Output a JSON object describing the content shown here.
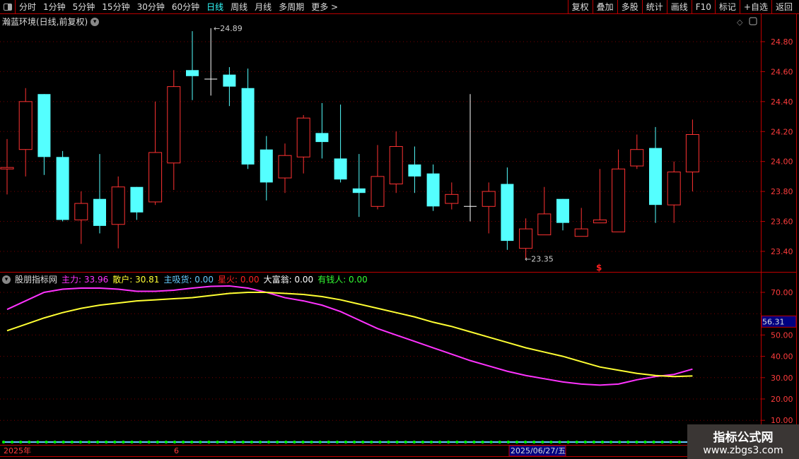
{
  "toolbar": {
    "periods": [
      "分时",
      "1分钟",
      "5分钟",
      "15分钟",
      "30分钟",
      "60分钟",
      "日线",
      "周线",
      "月线",
      "多周期",
      "更多 >"
    ],
    "active": "日线",
    "buttons": [
      "复权",
      "叠加",
      "多股",
      "统计",
      "画线",
      "F10",
      "标记",
      "+自选",
      "返回"
    ]
  },
  "main": {
    "title": "瀚蓝环境(日线,前复权)",
    "price_labels": [
      "24.80",
      "24.60",
      "24.40",
      "24.20",
      "24.00",
      "23.80",
      "23.60",
      "23.40"
    ],
    "high_label": "24.89",
    "low_label": "23.35",
    "marker": "$",
    "colors": {
      "up": "#ff3232",
      "down": "#54ffff",
      "doji": "#ffffff"
    },
    "candles": [
      [
        23.95,
        24.15,
        23.78,
        23.96
      ],
      [
        24.08,
        24.49,
        23.9,
        24.4
      ],
      [
        24.45,
        24.45,
        23.91,
        24.03
      ],
      [
        24.03,
        24.07,
        23.6,
        23.61
      ],
      [
        23.61,
        23.8,
        23.45,
        23.72
      ],
      [
        23.75,
        24.05,
        23.52,
        23.57
      ],
      [
        23.58,
        23.9,
        23.42,
        23.83
      ],
      [
        23.83,
        23.83,
        23.61,
        23.66
      ],
      [
        23.73,
        24.4,
        23.71,
        24.06
      ],
      [
        23.99,
        24.61,
        23.81,
        24.5
      ],
      [
        24.61,
        24.87,
        24.41,
        24.57
      ],
      [
        24.55,
        24.89,
        24.44,
        24.55
      ],
      [
        24.58,
        24.63,
        24.37,
        24.5
      ],
      [
        24.49,
        24.62,
        23.95,
        23.98
      ],
      [
        24.08,
        24.17,
        23.74,
        23.86
      ],
      [
        23.89,
        24.12,
        23.79,
        24.04
      ],
      [
        24.03,
        24.31,
        23.92,
        24.29
      ],
      [
        24.19,
        24.39,
        24.02,
        24.13
      ],
      [
        24.02,
        24.38,
        23.86,
        23.88
      ],
      [
        23.82,
        24.05,
        23.63,
        23.79
      ],
      [
        23.7,
        24.11,
        23.68,
        23.9
      ],
      [
        23.85,
        24.2,
        23.79,
        24.1
      ],
      [
        23.98,
        24.1,
        23.79,
        23.9
      ],
      [
        23.92,
        23.98,
        23.67,
        23.7
      ],
      [
        23.72,
        23.86,
        23.68,
        23.78
      ],
      [
        23.7,
        24.45,
        23.6,
        23.7
      ],
      [
        23.7,
        23.86,
        23.52,
        23.8
      ],
      [
        23.85,
        23.96,
        23.41,
        23.47
      ],
      [
        23.42,
        23.62,
        23.35,
        23.55
      ],
      [
        23.51,
        23.83,
        23.51,
        23.65
      ],
      [
        23.75,
        23.75,
        23.54,
        23.59
      ],
      [
        23.5,
        23.69,
        23.5,
        23.55
      ],
      [
        23.59,
        23.95,
        23.59,
        23.61
      ],
      [
        23.53,
        24.08,
        23.53,
        23.95
      ],
      [
        23.97,
        24.18,
        23.95,
        24.08
      ],
      [
        24.09,
        24.23,
        23.59,
        23.71
      ],
      [
        23.71,
        24.0,
        23.59,
        23.93
      ],
      [
        23.93,
        24.28,
        23.8,
        24.18
      ]
    ]
  },
  "indicator": {
    "name": "股朋指标网",
    "items": [
      {
        "label": "主力:",
        "value": "33.96",
        "color": "#ff33ff"
      },
      {
        "label": "散户:",
        "value": "30.81",
        "color": "#ffff33"
      },
      {
        "label": "主吸货:",
        "value": "0.00",
        "color": "#66ccff"
      },
      {
        "label": "星火:",
        "value": "0.00",
        "color": "#ff2020"
      },
      {
        "label": "大富翁:",
        "value": "0.00",
        "color": "#ffffff"
      },
      {
        "label": "有钱人:",
        "value": "0.00",
        "color": "#33ff33"
      }
    ],
    "axis_labels": [
      "70.00",
      "50.00",
      "40.00",
      "30.00",
      "20.00",
      "10.00"
    ],
    "cursor_value": "56.31",
    "zhuli": [
      62,
      66,
      70,
      71.5,
      72,
      72,
      71.5,
      70.5,
      70.5,
      71,
      72,
      72.8,
      73,
      72,
      70,
      67.5,
      66,
      64,
      61,
      57,
      53,
      50,
      47,
      44,
      41,
      38,
      35.5,
      33,
      31,
      29.5,
      28,
      27,
      26.5,
      27,
      29,
      30.5,
      31.5,
      34
    ],
    "sanhu": [
      52,
      55,
      58,
      60.5,
      62.5,
      64,
      65,
      66,
      66.5,
      67,
      67.5,
      68.5,
      69.5,
      70,
      70,
      69.5,
      69,
      68,
      66.5,
      64.5,
      62.5,
      60.5,
      58.5,
      56,
      54,
      51.5,
      49,
      46.5,
      44,
      42,
      40,
      37.5,
      35,
      33.5,
      32,
      31,
      30.5,
      30.8
    ]
  },
  "date_axis": {
    "labels": [
      "2025年",
      "6"
    ],
    "cursor_date": "2025/06/27/五"
  },
  "watermark": {
    "line1": "指标公式网",
    "line2": "www.zbgs3.com"
  }
}
